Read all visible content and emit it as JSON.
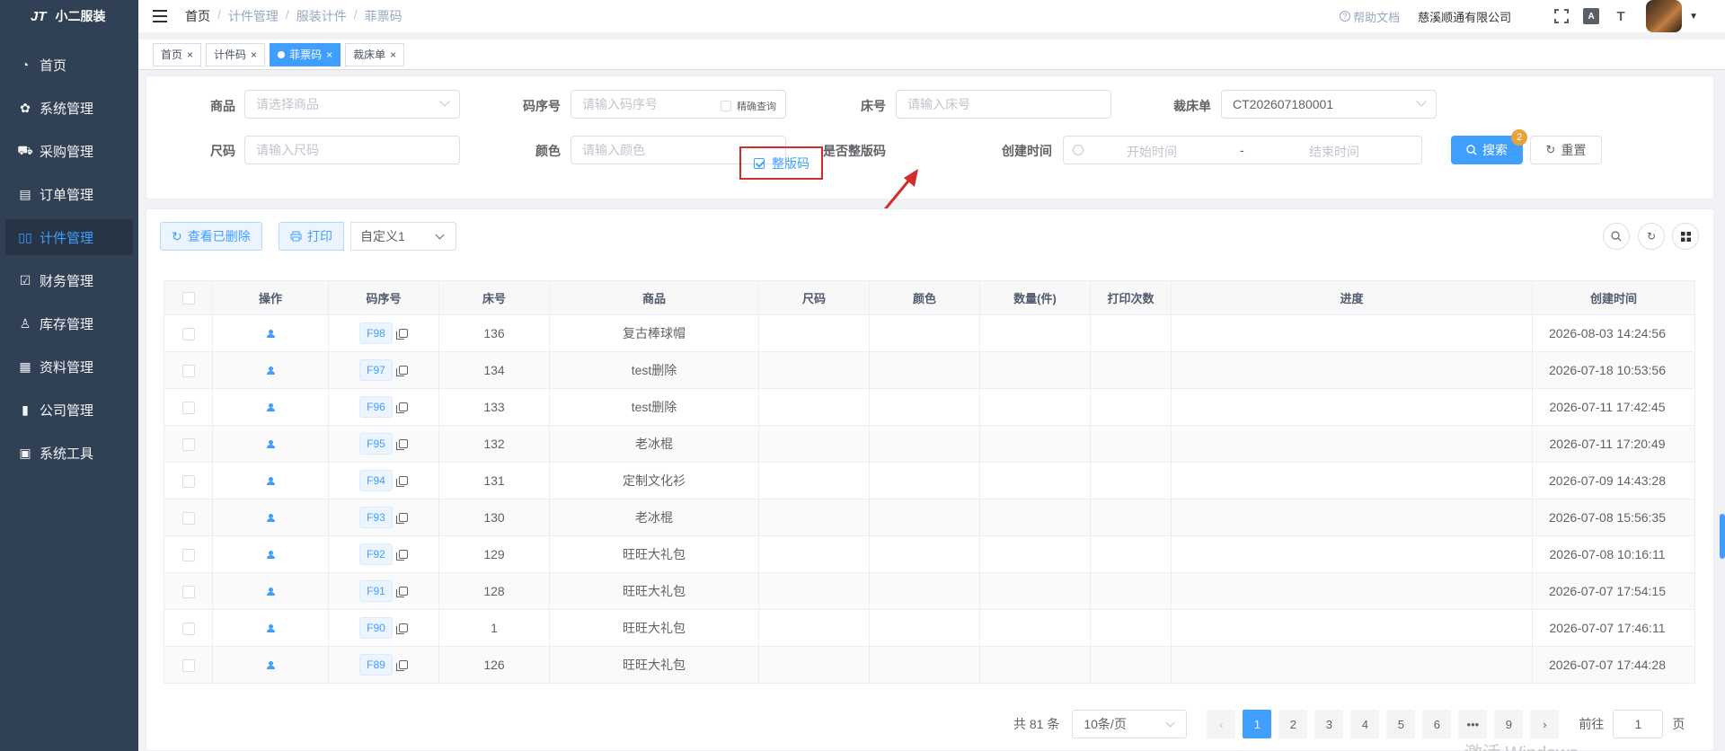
{
  "app": {
    "logo_mark": "JT",
    "name": "小二服装"
  },
  "sidebar": {
    "items": [
      {
        "label": "首页",
        "icon": "dashboard-icon",
        "glyph": "◔",
        "active": false
      },
      {
        "label": "系统管理",
        "icon": "gear-icon",
        "glyph": "✿",
        "active": false
      },
      {
        "label": "采购管理",
        "icon": "cart-icon",
        "glyph": "⛟",
        "active": false
      },
      {
        "label": "订单管理",
        "icon": "order-icon",
        "glyph": "▤",
        "active": false
      },
      {
        "label": "计件管理",
        "icon": "book-icon",
        "glyph": "▯▯",
        "active": true
      },
      {
        "label": "财务管理",
        "icon": "finance-chart-icon",
        "glyph": "☑",
        "active": false
      },
      {
        "label": "库存管理",
        "icon": "user-icon",
        "glyph": "♙",
        "active": false
      },
      {
        "label": "资料管理",
        "icon": "document-icon",
        "glyph": "▦",
        "active": false
      },
      {
        "label": "公司管理",
        "icon": "bar-chart-icon",
        "glyph": "▮",
        "active": false
      },
      {
        "label": "系统工具",
        "icon": "toolbox-icon",
        "glyph": "▣",
        "active": false
      }
    ]
  },
  "header": {
    "breadcrumb": [
      "首页",
      "计件管理",
      "服装计件",
      "菲票码"
    ],
    "breadcrumb_sep": "/",
    "help_label": "帮助文档",
    "company": "慈溪顺通有限公司",
    "icons": [
      "fullscreen-icon",
      "font-icon",
      "text-size-icon"
    ],
    "font_icon_text": "A",
    "text_size_icon_text": "T"
  },
  "tags": [
    {
      "label": "首页",
      "active": false
    },
    {
      "label": "计件码",
      "active": false
    },
    {
      "label": "菲票码",
      "active": true
    },
    {
      "label": "裁床单",
      "active": false
    }
  ],
  "search": {
    "product_label": "商品",
    "product_placeholder": "请选择商品",
    "seq_label": "码序号",
    "seq_placeholder": "请输入码序号",
    "exact_label": "精确查询",
    "bed_label": "床号",
    "bed_placeholder": "请输入床号",
    "cut_label": "裁床单",
    "cut_value": "CT202607180001",
    "size_label": "尺码",
    "size_placeholder": "请输入尺码",
    "color_label": "颜色",
    "color_placeholder": "请输入颜色",
    "whole_label": "是否整版码",
    "whole_check_label": "整版码",
    "whole_checked": true,
    "created_label": "创建时间",
    "start_placeholder": "开始时间",
    "range_sep": "-",
    "end_placeholder": "结束时间",
    "search_button": "搜索",
    "search_badge": "2",
    "reset_button": "重置"
  },
  "toolbar": {
    "view_deleted": "查看已删除",
    "print": "打印",
    "template_select": "自定义1"
  },
  "table": {
    "columns": [
      "操作",
      "码序号",
      "床号",
      "商品",
      "尺码",
      "颜色",
      "数量(件)",
      "打印次数",
      "进度",
      "创建时间"
    ],
    "rows": [
      {
        "code": "F98",
        "bed": "136",
        "product": "复古棒球帽",
        "size": "",
        "color": "",
        "qty": "",
        "prints": "",
        "progress": "",
        "created": "2026-08-03 14:24:56"
      },
      {
        "code": "F97",
        "bed": "134",
        "product": "test删除",
        "size": "",
        "color": "",
        "qty": "",
        "prints": "",
        "progress": "",
        "created": "2026-07-18 10:53:56"
      },
      {
        "code": "F96",
        "bed": "133",
        "product": "test删除",
        "size": "",
        "color": "",
        "qty": "",
        "prints": "",
        "progress": "",
        "created": "2026-07-11 17:42:45"
      },
      {
        "code": "F95",
        "bed": "132",
        "product": "老冰棍",
        "size": "",
        "color": "",
        "qty": "",
        "prints": "",
        "progress": "",
        "created": "2026-07-11 17:20:49"
      },
      {
        "code": "F94",
        "bed": "131",
        "product": "定制文化衫",
        "size": "",
        "color": "",
        "qty": "",
        "prints": "",
        "progress": "",
        "created": "2026-07-09 14:43:28"
      },
      {
        "code": "F93",
        "bed": "130",
        "product": "老冰棍",
        "size": "",
        "color": "",
        "qty": "",
        "prints": "",
        "progress": "",
        "created": "2026-07-08 15:56:35"
      },
      {
        "code": "F92",
        "bed": "129",
        "product": "旺旺大礼包",
        "size": "",
        "color": "",
        "qty": "",
        "prints": "",
        "progress": "",
        "created": "2026-07-08 10:16:11"
      },
      {
        "code": "F91",
        "bed": "128",
        "product": "旺旺大礼包",
        "size": "",
        "color": "",
        "qty": "",
        "prints": "",
        "progress": "",
        "created": "2026-07-07 17:54:15"
      },
      {
        "code": "F90",
        "bed": "1",
        "product": "旺旺大礼包",
        "size": "",
        "color": "",
        "qty": "",
        "prints": "",
        "progress": "",
        "created": "2026-07-07 17:46:11"
      },
      {
        "code": "F89",
        "bed": "126",
        "product": "旺旺大礼包",
        "size": "",
        "color": "",
        "qty": "",
        "prints": "",
        "progress": "",
        "created": "2026-07-07 17:44:28"
      }
    ]
  },
  "pagination": {
    "total": "共 81 条",
    "page_size": "10条/页",
    "pages": [
      "1",
      "2",
      "3",
      "4",
      "5",
      "6",
      "•••",
      "9"
    ],
    "current": "1",
    "prev": "‹",
    "next": "›",
    "goto_label": "前往",
    "goto_value": "1",
    "goto_suffix": "页"
  },
  "watermark": "激活 Windows",
  "colors": {
    "primary": "#409eff",
    "sidebar": "#304156",
    "highlight_border": "#d42b2b",
    "badge": "#e6a23c"
  }
}
